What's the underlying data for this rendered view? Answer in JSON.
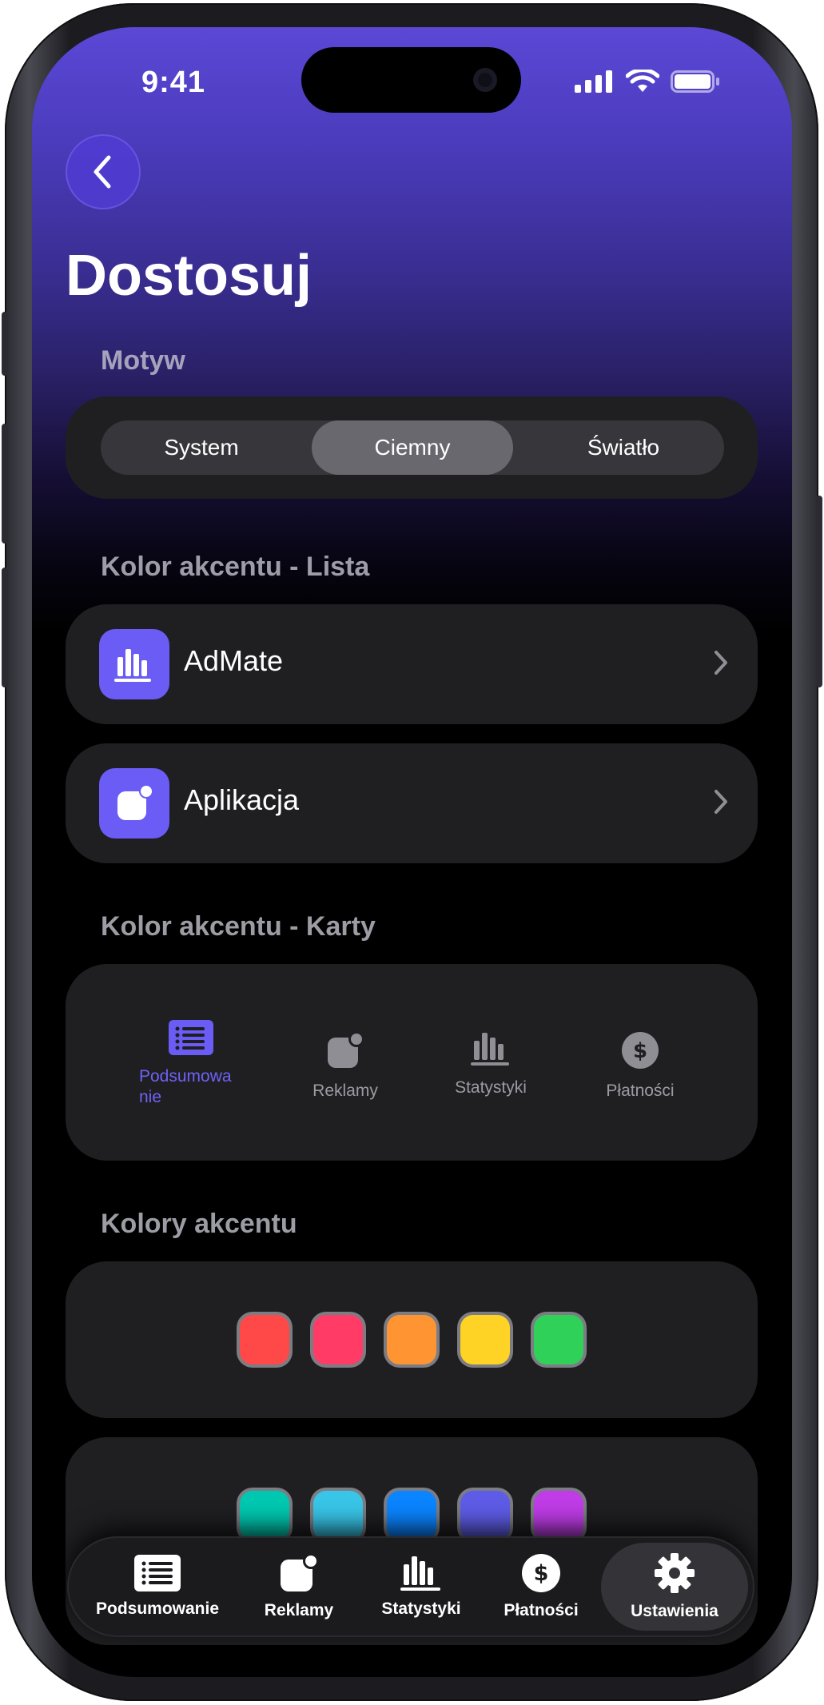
{
  "status_bar": {
    "time": "9:41"
  },
  "header": {
    "title": "Dostosuj"
  },
  "theme": {
    "label": "Motyw",
    "options": [
      "System",
      "Ciemny",
      "Światło"
    ],
    "selected": "Ciemny"
  },
  "accent_list": {
    "label": "Kolor akcentu - Lista",
    "items": [
      {
        "label": "AdMate",
        "icon": "chart-bars-icon"
      },
      {
        "label": "Aplikacja",
        "icon": "app-badge-icon"
      }
    ]
  },
  "accent_cards": {
    "label": "Kolor akcentu - Karty",
    "tabs": [
      {
        "label": "Podsumowa\nnie",
        "icon": "list-icon",
        "selected": true
      },
      {
        "label": "Reklamy",
        "icon": "app-badge-icon",
        "selected": false
      },
      {
        "label": "Statystyki",
        "icon": "chart-bars-icon",
        "selected": false
      },
      {
        "label": "Płatności",
        "icon": "dollar-icon",
        "selected": false
      }
    ]
  },
  "accent_colors": {
    "label": "Kolory akcentu",
    "row1": [
      "#ff4848",
      "#ff3b66",
      "#ff9433",
      "#ffd326",
      "#30d158"
    ],
    "row2": [
      "#00c8b0",
      "#38c5e8",
      "#0a84ff",
      "#5e5ce6",
      "#bf3ce6"
    ]
  },
  "tab_bar": {
    "items": [
      {
        "label": "Podsumowanie",
        "icon": "list-icon"
      },
      {
        "label": "Reklamy",
        "icon": "app-badge-icon"
      },
      {
        "label": "Statystyki",
        "icon": "chart-bars-icon"
      },
      {
        "label": "Płatności",
        "icon": "dollar-icon"
      },
      {
        "label": "Ustawienia",
        "icon": "gear-icon"
      }
    ],
    "active": "Ustawienia"
  },
  "colors": {
    "accent": "#6a5cf5",
    "header_gradient_top": "#5b48d6",
    "card_background": "#1f1f22"
  }
}
